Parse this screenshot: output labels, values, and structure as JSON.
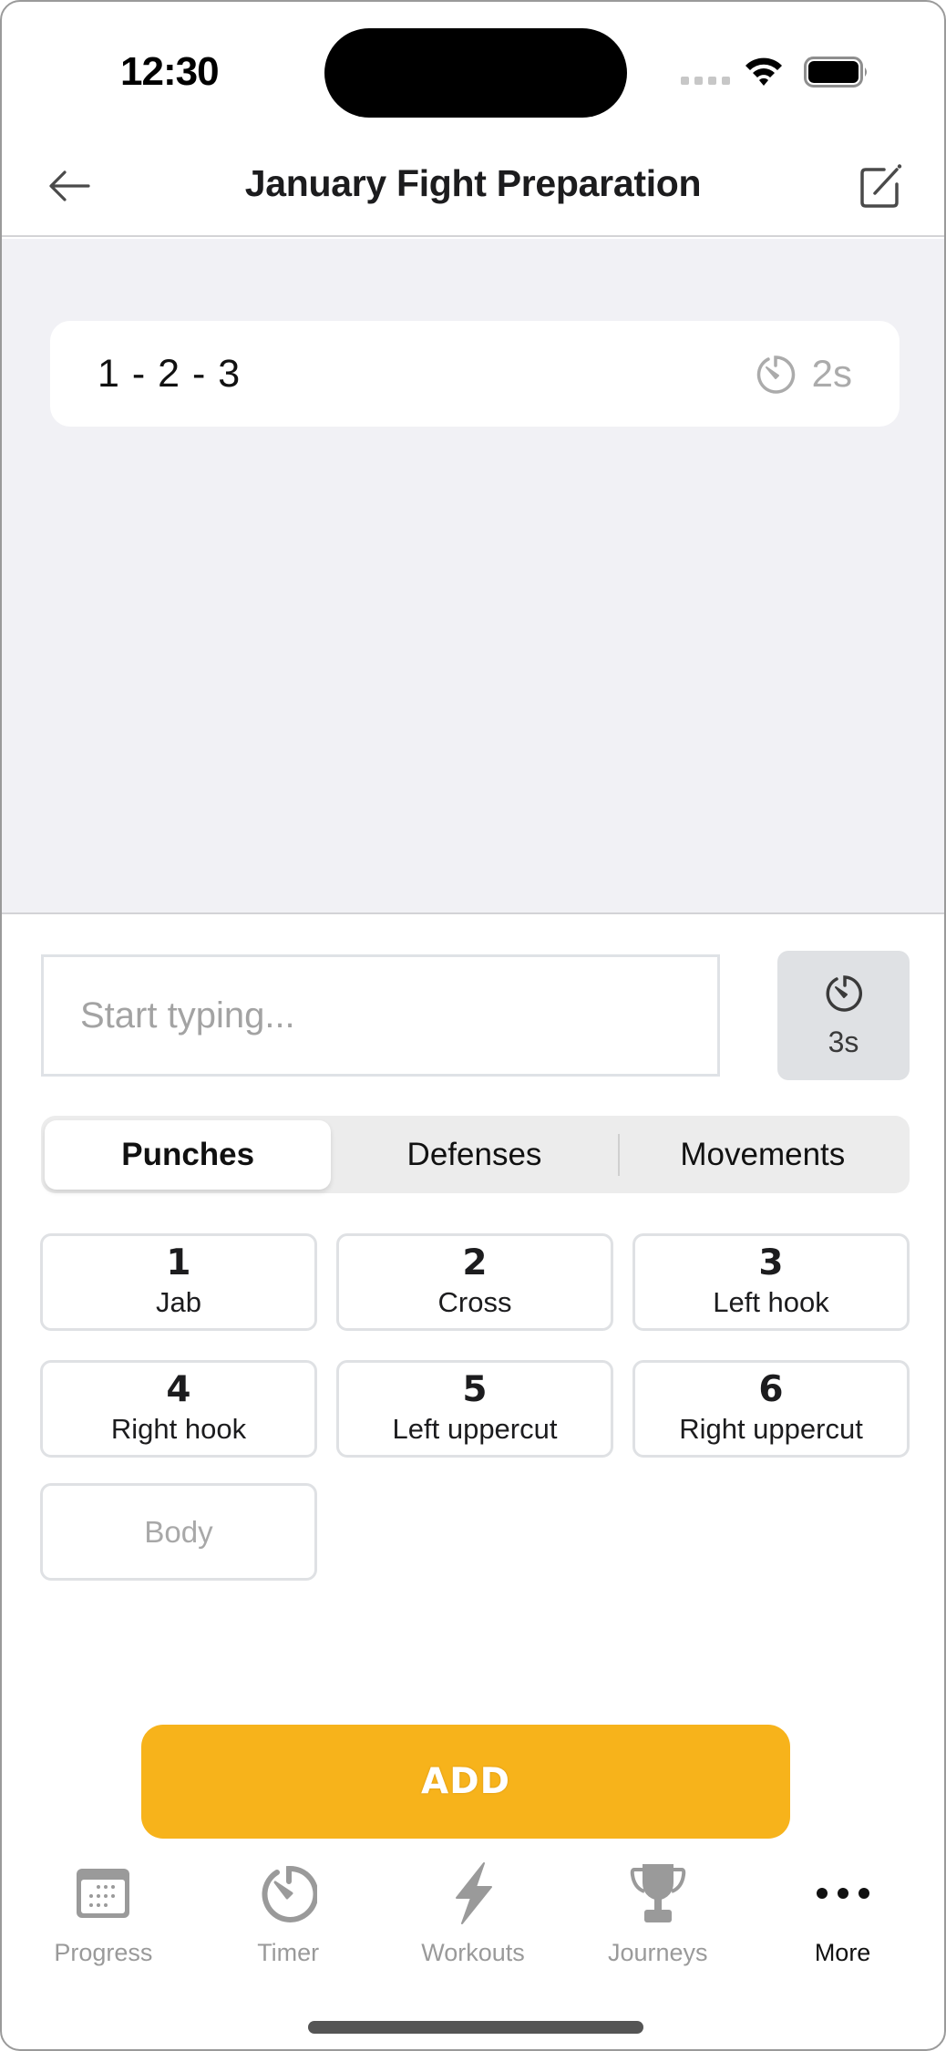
{
  "status_bar": {
    "time": "12:30"
  },
  "header": {
    "title": "January Fight Preparation",
    "back_icon": "arrow-left-icon",
    "edit_icon": "square-pencil-icon"
  },
  "combos": [
    {
      "text": "1 - 2 - 3",
      "duration": "2s",
      "icon": "timer-icon"
    }
  ],
  "composer": {
    "input_placeholder": "Start typing...",
    "input_value": "",
    "time_button_label": "3s",
    "time_button_icon": "timer-icon"
  },
  "segments": {
    "items": [
      {
        "label": "Punches",
        "active": true
      },
      {
        "label": "Defenses",
        "active": false
      },
      {
        "label": "Movements",
        "active": false
      }
    ]
  },
  "punches": [
    {
      "number": "1",
      "name": "Jab"
    },
    {
      "number": "2",
      "name": "Cross"
    },
    {
      "number": "3",
      "name": "Left hook"
    },
    {
      "number": "4",
      "name": "Right hook"
    },
    {
      "number": "5",
      "name": "Left uppercut"
    },
    {
      "number": "6",
      "name": "Right uppercut"
    }
  ],
  "modifier": {
    "body_label": "Body"
  },
  "actions": {
    "add_label": "ADD"
  },
  "colors": {
    "accent": "#f7b31b",
    "list_background": "#f1f1f5",
    "inactive_tab": "#9a9a9a",
    "active_tab": "#111111"
  },
  "tab_bar": {
    "items": [
      {
        "label": "Progress",
        "icon": "calendar-icon",
        "active": false
      },
      {
        "label": "Timer",
        "icon": "timer-icon",
        "active": false
      },
      {
        "label": "Workouts",
        "icon": "lightning-bolt-icon",
        "active": false
      },
      {
        "label": "Journeys",
        "icon": "trophy-icon",
        "active": false
      },
      {
        "label": "More",
        "icon": "more-dots-icon",
        "active": true
      }
    ]
  }
}
